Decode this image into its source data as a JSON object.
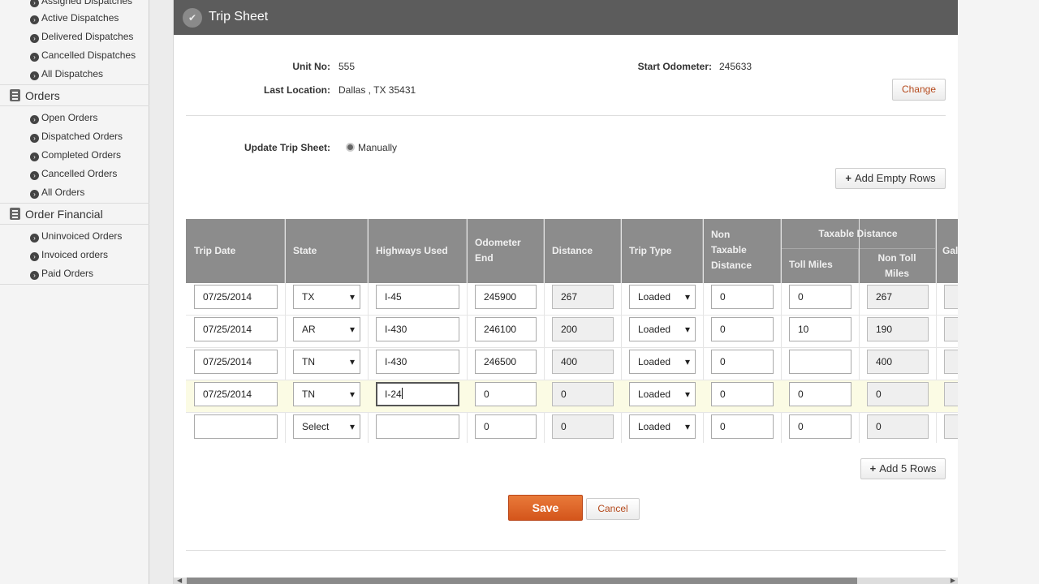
{
  "sidebar": {
    "dispatch_items": [
      "Assigned Dispatches",
      "Active Dispatches",
      "Delivered Dispatches",
      "Cancelled Dispatches",
      "All Dispatches"
    ],
    "orders_title": "Orders",
    "orders_items": [
      "Open Orders",
      "Dispatched Orders",
      "Completed Orders",
      "Cancelled Orders",
      "All Orders"
    ],
    "financial_title": "Order Financial",
    "financial_items": [
      "Uninvoiced Orders",
      "Invoiced orders",
      "Paid Orders"
    ]
  },
  "panel": {
    "title": "Trip Sheet",
    "unit_no_label": "Unit No:",
    "unit_no": "555",
    "start_odometer_label": "Start Odometer:",
    "start_odometer": "245633",
    "last_location_label": "Last Location:",
    "last_location": "Dallas , TX 35431",
    "change_label": "Change",
    "update_label": "Update Trip Sheet:",
    "update_mode": "Manually",
    "add_empty_rows": "Add Empty Rows",
    "add_5_rows": "Add 5 Rows",
    "save_label": "Save",
    "cancel_label": "Cancel"
  },
  "table": {
    "headers": {
      "trip_date": "Trip Date",
      "state": "State",
      "highways": "Highways Used",
      "odometer_end": "Odometer End",
      "distance": "Distance",
      "trip_type": "Trip Type",
      "non_taxable": "Non Taxable Distance",
      "taxable_group": "Taxable Distance",
      "toll_miles": "Toll Miles",
      "non_toll_miles": "Non Toll Miles",
      "gal": "Gal"
    },
    "rows": [
      {
        "date": "07/25/2014",
        "state": "TX",
        "highway": "I-45",
        "odo": "245900",
        "distance": "267",
        "type": "Loaded",
        "non_taxable": "0",
        "toll": "0",
        "non_toll": "267"
      },
      {
        "date": "07/25/2014",
        "state": "AR",
        "highway": "I-430",
        "odo": "246100",
        "distance": "200",
        "type": "Loaded",
        "non_taxable": "0",
        "toll": "10",
        "non_toll": "190"
      },
      {
        "date": "07/25/2014",
        "state": "TN",
        "highway": "I-430",
        "odo": "246500",
        "distance": "400",
        "type": "Loaded",
        "non_taxable": "0",
        "toll": "",
        "non_toll": "400"
      },
      {
        "date": "07/25/2014",
        "state": "TN",
        "highway": "I-24",
        "odo": "0",
        "distance": "0",
        "type": "Loaded",
        "non_taxable": "0",
        "toll": "0",
        "non_toll": "0"
      },
      {
        "date": "",
        "state": "Select",
        "highway": "",
        "odo": "0",
        "distance": "0",
        "type": "Loaded",
        "non_taxable": "0",
        "toll": "0",
        "non_toll": "0"
      }
    ]
  }
}
